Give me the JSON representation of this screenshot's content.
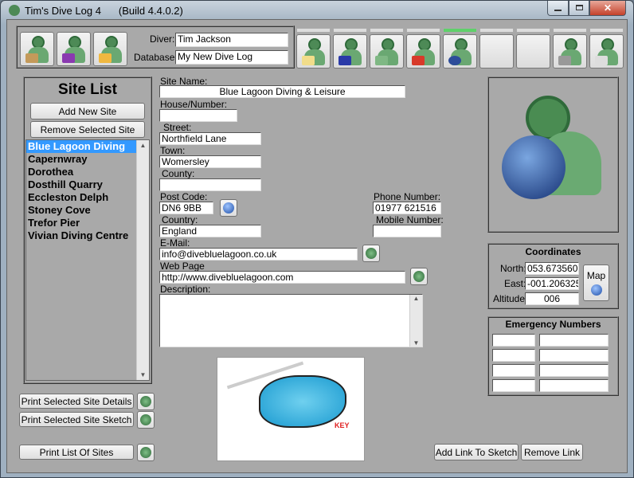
{
  "window": {
    "title": "Tim's Dive Log 4",
    "build": "(Build 4.4.0.2)"
  },
  "toolbar": {
    "diver_label": "Diver:",
    "diver_value": "Tim Jackson",
    "database_label": "Database:",
    "database_value": "My New Dive Log",
    "left_buttons": [
      "new-log-icon",
      "save-icon",
      "open-folder-icon"
    ],
    "tabs": [
      "certificate-icon",
      "dive-bag-icon",
      "buddies-icon",
      "home-icon",
      "globe-icon",
      "blank",
      "blank",
      "tools-icon",
      "logbook-icon"
    ]
  },
  "site_list": {
    "title": "Site List",
    "add_label": "Add New Site",
    "remove_label": "Remove Selected Site",
    "items": [
      "Blue Lagoon Diving",
      "Capernwray",
      "Dorothea",
      "Dosthill Quarry",
      "Eccleston Delph",
      "Stoney Cove",
      "Trefor Pier",
      "Vivian Diving Centre"
    ],
    "selected": 0
  },
  "form": {
    "site_name_label": "Site Name:",
    "site_name": "Blue Lagoon Diving & Leisure",
    "house_label": "House/Number:",
    "house": "",
    "street_label": "Street:",
    "street": "Northfield Lane",
    "town_label": "Town:",
    "town": "Womersley",
    "county_label": "County:",
    "county": "",
    "postcode_label": "Post Code:",
    "postcode": "DN6 9BB",
    "country_label": "Country:",
    "country": "England",
    "phone_label": "Phone Number:",
    "phone": "01977 621516",
    "mobile_label": "Mobile Number:",
    "mobile": "",
    "email_label": "E-Mail:",
    "email": "info@divebluelagoon.co.uk",
    "web_label": "Web Page",
    "web": "http://www.divebluelagoon.com",
    "description_label": "Description:",
    "description": ""
  },
  "coordinates": {
    "title": "Coordinates",
    "north_label": "North:",
    "north": "053.673560",
    "east_label": "East:",
    "east": "-001.206325",
    "altitude_label": "Altitude:",
    "altitude": "006",
    "map_label": "Map"
  },
  "emergency": {
    "title": "Emergency Numbers"
  },
  "sketch": {
    "key_label": "KEY"
  },
  "bottom": {
    "print_details": "Print Selected Site Details",
    "print_sketch": "Print Selected Site Sketch",
    "print_list": "Print List Of Sites",
    "add_link": "Add Link To Sketch",
    "remove_link": "Remove Link"
  }
}
